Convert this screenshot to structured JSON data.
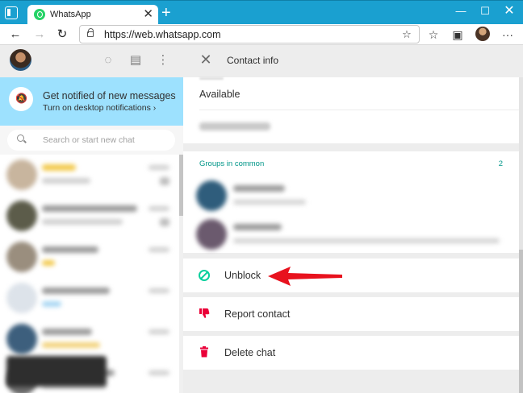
{
  "browser": {
    "tab_title": "WhatsApp",
    "tab_close": "✕",
    "new_tab": "+",
    "url": "https://web.whatsapp.com",
    "window_controls": {
      "minimize": "—",
      "maximize": "☐",
      "close": "✕"
    },
    "icons": {
      "back": "←",
      "forward": "→",
      "reload": "↻",
      "favorites_add": "☆",
      "favorites": "☆",
      "collections": "▣",
      "menu": "···"
    }
  },
  "left_pane": {
    "header_icons": {
      "status": "◌",
      "new_chat": "▤",
      "menu": "⋮"
    },
    "notification": {
      "title": "Get notified of new messages",
      "subtitle": "Turn on desktop notifications ›"
    },
    "search": {
      "placeholder": "Search or start new chat"
    }
  },
  "contact_info": {
    "title": "Contact info",
    "close_icon": "✕",
    "about": "Available",
    "groups_label": "Groups in common",
    "groups_count": "2",
    "actions": {
      "unblock": "Unblock",
      "report": "Report contact",
      "delete": "Delete chat"
    }
  },
  "colors": {
    "accent_teal": "#009688",
    "unblock_green": "#06cf9c",
    "danger_red": "#ea0038",
    "notification_bg": "#9de1fe",
    "browser_titlebar": "#1aa0d0",
    "annotation_arrow": "#e8121e"
  }
}
